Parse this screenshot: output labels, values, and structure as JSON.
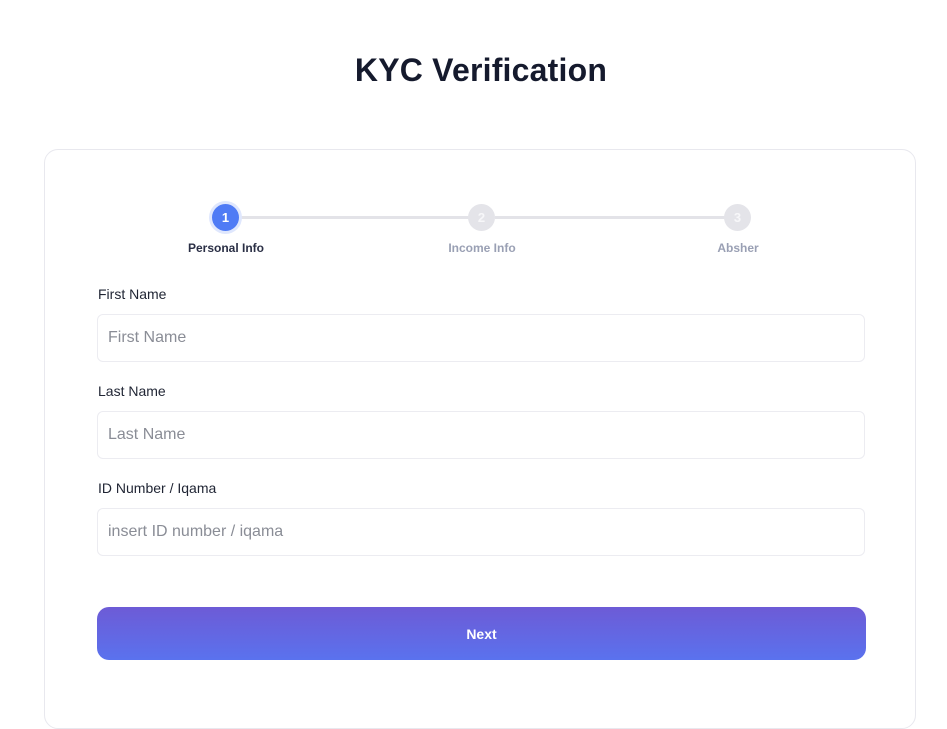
{
  "page": {
    "title": "KYC Verification"
  },
  "stepper": {
    "steps": [
      {
        "number": "1",
        "label": "Personal Info",
        "state": "active"
      },
      {
        "number": "2",
        "label": "Income Info",
        "state": "inactive"
      },
      {
        "number": "3",
        "label": "Absher",
        "state": "inactive"
      }
    ]
  },
  "form": {
    "first_name": {
      "label": "First Name",
      "placeholder": "First Name",
      "value": ""
    },
    "last_name": {
      "label": "Last Name",
      "placeholder": "Last Name",
      "value": ""
    },
    "id_number": {
      "label": "ID Number / Iqama",
      "placeholder": "insert ID number / iqama",
      "value": ""
    },
    "next_label": "Next"
  },
  "colors": {
    "accent": "#4f7bf5",
    "button_gradient_start": "#6d5bd6",
    "button_gradient_end": "#5a72ee",
    "inactive_step": "#e4e4e9"
  }
}
